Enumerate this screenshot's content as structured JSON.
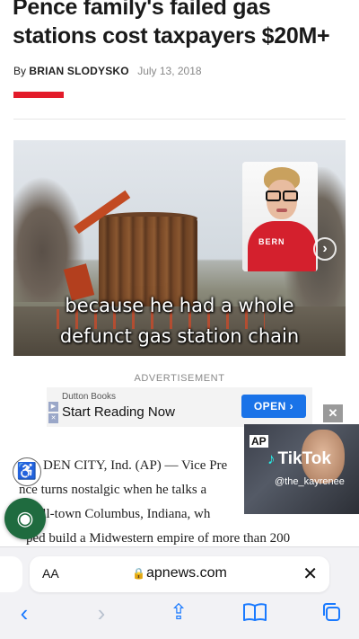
{
  "article": {
    "headline": "Pence family's failed gas stations cost taxpayers $20M+",
    "byline_prefix": "By",
    "author": "BRIAN SLODYSKO",
    "date": "July 13, 2018"
  },
  "video": {
    "caption_line1": "because he had a whole",
    "caption_line2": "defunct gas station chain",
    "shirt_text": "BERN",
    "next_icon": "chevron-right-icon"
  },
  "ad": {
    "label": "ADVERTISEMENT",
    "brand": "Dutton Books",
    "cta_text": "Start Reading Now",
    "button_label": "OPEN ›",
    "adchoices_icons": [
      "play-icon",
      "close-icon"
    ]
  },
  "body": {
    "line1": "DEN CITY, Ind. (AP) — Vice Pre",
    "line2": "nce turns nostalgic when he talks a",
    "line3": "mall-town Columbus, Indiana, wh",
    "line4": "ped build a Midwestern empire of more than 200"
  },
  "tiktok_overlay": {
    "badge": "AP",
    "brand": "TikTok",
    "handle": "@the_kayrenee",
    "close_label": "✕"
  },
  "floating": {
    "accessibility_icon": "accessibility-icon",
    "cookie_icon": "cookie-icon"
  },
  "browser": {
    "text_size_label": "AA",
    "domain": "apnews.com",
    "lock_icon": "lock-icon",
    "clear_label": "✕",
    "toolbar": {
      "back": "‹",
      "forward": "›",
      "share": "⇪",
      "bookmarks": "📖",
      "tabs": "⧉"
    }
  }
}
